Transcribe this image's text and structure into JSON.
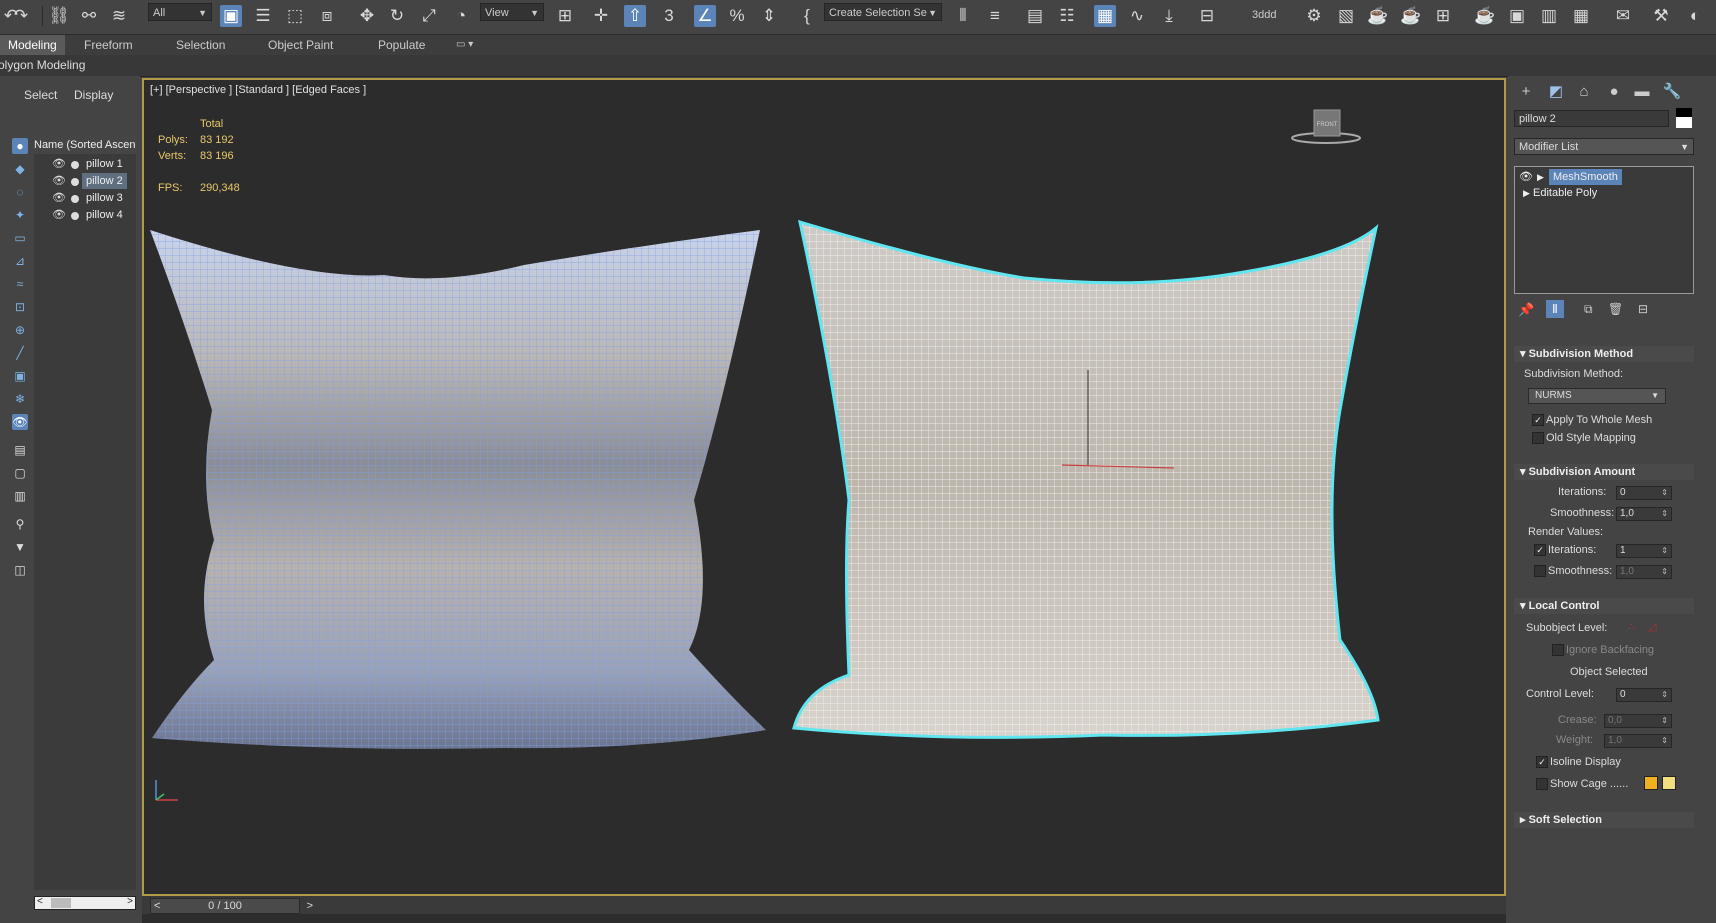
{
  "toolbar": {
    "selection_filter": "All",
    "ref_coord": "View",
    "named_selection": "Create Selection Se",
    "snap_label": "3",
    "angle_snap": "3ddd"
  },
  "ribbon": {
    "tabs": [
      "Modeling",
      "Freeform",
      "Selection",
      "Object Paint",
      "Populate"
    ],
    "active_tab": "Modeling",
    "sub_label": "Polygon Modeling"
  },
  "scene_explorer": {
    "tabs": [
      "Select",
      "Display"
    ],
    "header": "Name (Sorted Ascending)",
    "items": [
      "pillow 1",
      "pillow 2",
      "pillow 3",
      "pillow 4"
    ],
    "selected": "pillow 2"
  },
  "viewport": {
    "label": "[+] [Perspective ] [Standard ] [Edged Faces ]",
    "stats": {
      "total_label": "Total",
      "polys_label": "Polys:",
      "polys_value": "83 192",
      "verts_label": "Verts:",
      "verts_value": "83 196",
      "fps_label": "FPS:",
      "fps_value": "290,348"
    },
    "viewcube_label": "FRONT"
  },
  "timeline": {
    "frame": "0 / 100"
  },
  "command_panel": {
    "object_name": "pillow 2",
    "modifier_list": "Modifier List",
    "stack": [
      "MeshSmooth",
      "Editable Poly"
    ],
    "subdivision_method": {
      "title": "Subdivision Method",
      "method_label": "Subdivision Method:",
      "method_value": "NURMS",
      "apply_whole_mesh": "Apply To Whole Mesh",
      "old_style": "Old Style Mapping"
    },
    "subdivision_amount": {
      "title": "Subdivision Amount",
      "iterations_label": "Iterations:",
      "iterations_value": "0",
      "smoothness_label": "Smoothness:",
      "smoothness_value": "1,0",
      "render_values": "Render Values:",
      "render_iterations_label": "Iterations:",
      "render_iterations_value": "1",
      "render_smoothness_label": "Smoothness:",
      "render_smoothness_value": "1,0"
    },
    "local_control": {
      "title": "Local Control",
      "subobject_label": "Subobject Level:",
      "ignore_backfacing": "Ignore Backfacing",
      "object_selected": "Object Selected",
      "control_level_label": "Control Level:",
      "control_level_value": "0",
      "crease_label": "Crease:",
      "crease_value": "0,0",
      "weight_label": "Weight:",
      "weight_value": "1,0",
      "isoline": "Isoline Display",
      "show_cage": "Show Cage ......"
    },
    "soft_selection": {
      "title": "Soft Selection"
    }
  }
}
